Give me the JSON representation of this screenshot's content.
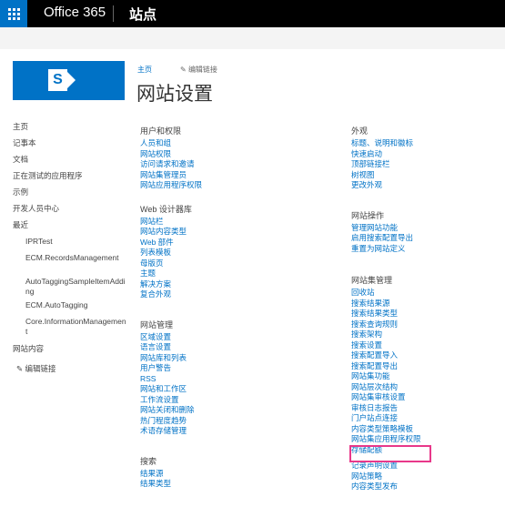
{
  "suite": {
    "brand": "Office 365",
    "site_label": "站点"
  },
  "page": {
    "breadcrumb": "主页",
    "edit_links": "编辑链接",
    "title": "网站设置"
  },
  "quicklaunch": {
    "items": [
      "主页",
      "记事本",
      "文档",
      "正在测试的应用程序",
      "示例",
      "开发人员中心",
      "最近"
    ],
    "recent": [
      "IPRTest",
      "ECM.RecordsManagement",
      "AutoTaggingSampleItemAdding",
      "ECM.AutoTagging",
      "Core.InformationManagement"
    ],
    "site_contents": "网站内容",
    "edit_links": "编辑链接"
  },
  "columns": {
    "users": {
      "heading": "用户和权限",
      "links": [
        "人员和组",
        "网站权限",
        "访问请求和邀请",
        "网站集管理员",
        "网站应用程序权限"
      ]
    },
    "webdesign": {
      "heading": "Web 设计器库",
      "links": [
        "网站栏",
        "网站内容类型",
        "Web 部件",
        "列表模板",
        "母版页",
        "主题",
        "解决方案",
        "复合外观"
      ]
    },
    "siteadmin": {
      "heading": "网站管理",
      "links": [
        "区域设置",
        "语言设置",
        "网站库和列表",
        "用户警告",
        "RSS",
        "网站和工作区",
        "工作流设置",
        "网站关闭和删除",
        "热门程度趋势",
        "术语存储管理"
      ]
    },
    "search": {
      "heading": "搜索",
      "links": [
        "结果源",
        "结果类型"
      ]
    },
    "look": {
      "heading": "外观",
      "links": [
        "标题、说明和徽标",
        "快速启动",
        "顶部链接栏",
        "树视图",
        "更改外观"
      ]
    },
    "actions": {
      "heading": "网站操作",
      "links": [
        "管理网站功能",
        "启用搜索配置导出",
        "重置为网站定义"
      ]
    },
    "collection": {
      "heading": "网站集管理",
      "links": [
        "回收站",
        "搜索结果源",
        "搜索结果类型",
        "搜索查询规则",
        "搜索架构",
        "搜索设置",
        "搜索配置导入",
        "搜索配置导出",
        "网站集功能",
        "网站层次结构",
        "网站集审核设置",
        "审核日志报告",
        "门户站点连接",
        "内容类型策略模板",
        "网站集应用程序权限",
        "存储配额",
        "记录声明设置",
        "网站策略",
        "内容类型发布"
      ]
    }
  },
  "highlight_color": "#e8388a"
}
